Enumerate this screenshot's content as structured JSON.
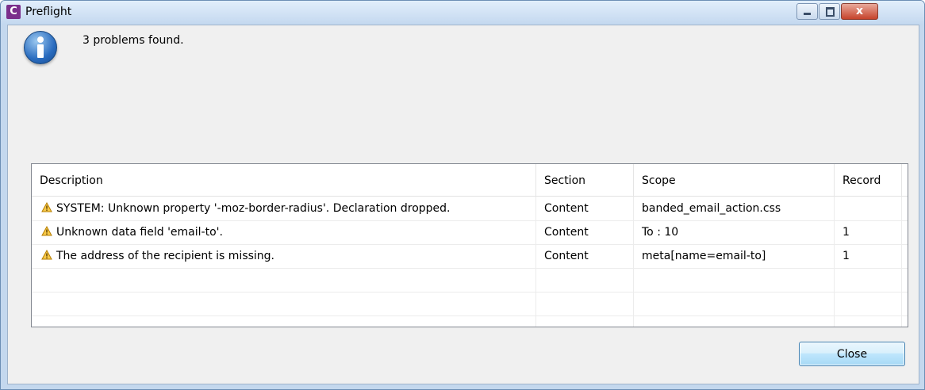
{
  "window": {
    "title": "Preflight",
    "app_icon_letter": "C",
    "controls": {
      "minimize": "minimize-icon",
      "maximize": "maximize-icon",
      "close_glyph": "x"
    }
  },
  "message": "3 problems found.",
  "table": {
    "columns": [
      "Description",
      "Section",
      "Scope",
      "Record"
    ],
    "rows": [
      {
        "description": "SYSTEM: Unknown property '-moz-border-radius'.  Declaration dropped.",
        "section": "Content",
        "scope": "banded_email_action.css",
        "record": ""
      },
      {
        "description": "Unknown data field 'email-to'.",
        "section": "Content",
        "scope": "To : 10",
        "record": "1"
      },
      {
        "description": "The address of the recipient is missing.",
        "section": "Content",
        "scope": "meta[name=email-to]",
        "record": "1"
      }
    ]
  },
  "buttons": {
    "close_label": "Close"
  },
  "colors": {
    "warning": "#e8a300",
    "accent": "#3c7fb1",
    "app_icon": "#7b2f8c"
  }
}
